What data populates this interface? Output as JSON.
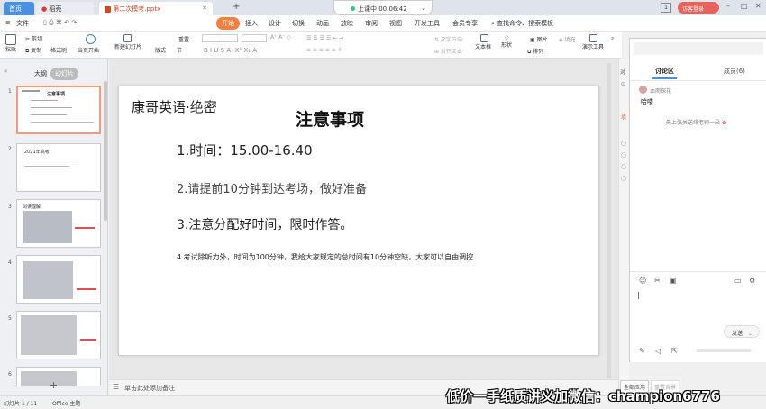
{
  "titlebar": {
    "home_tab": "首页",
    "daoke_tab": "稻壳",
    "file_tab": "第二次模考.pptx",
    "add_tab": "+",
    "status_label": "上课中 00:06:42",
    "visitor_label": "访客登录",
    "page_badge": "1"
  },
  "menubar": {
    "file": "文件",
    "items": [
      "开始",
      "插入",
      "设计",
      "切换",
      "动画",
      "放映",
      "审阅",
      "视图",
      "开发工具",
      "会员专享"
    ],
    "search": "查找命令、搜索模板"
  },
  "toolbar": {
    "paste": "粘贴",
    "cut": "剪切",
    "copy": "复制",
    "format_painter": "格式刷",
    "play_current": "当页开始",
    "new_slide": "新建幻灯片",
    "layout": "版式",
    "section": "节",
    "reset": "重置",
    "textbox": "文本框",
    "shape": "形状",
    "arrange": "排列",
    "picture": "图片",
    "fill": "填充",
    "presenter_tools": "演示工具",
    "find": "查找"
  },
  "leftpanel": {
    "outline_tab": "大纲",
    "slides_tab": "幻灯片",
    "thumbs": [
      {
        "num": "1",
        "title": "注意事项"
      },
      {
        "num": "2",
        "title": "2021年高考"
      },
      {
        "num": "3",
        "title": "阅读理解"
      },
      {
        "num": "4",
        "title": ""
      },
      {
        "num": "5",
        "title": ""
      },
      {
        "num": "6",
        "title": ""
      }
    ],
    "add_button": "+"
  },
  "slide": {
    "brand": "康哥英语·绝密",
    "title": "注意事项",
    "line1": "1.时间：15.00-16.40",
    "line2": "2.请提前10分钟到达考场，做好准备",
    "line3": "3.注意分配好时间，限时作答。",
    "line4": "4.考试除听力外，时间为100分钟，我给大家规定的总时间有10分钟空缺，大家可以自由调控"
  },
  "notes": {
    "placeholder": "单击此处添加备注"
  },
  "statusbar": {
    "slide_index": "幻灯片 1 / 11",
    "theme": "Office 主题",
    "apply_all": "全部应用",
    "reset_style": "重置背景"
  },
  "chat": {
    "tab_discussion": "讨论区",
    "tab_members": "成员(6)",
    "sender": "血雨探花",
    "message": "哈喽",
    "notice": "失上张关送绯老师一朵",
    "send_button": "发送"
  },
  "watermark": "低价一手纸质讲义加微信：champion6776"
}
